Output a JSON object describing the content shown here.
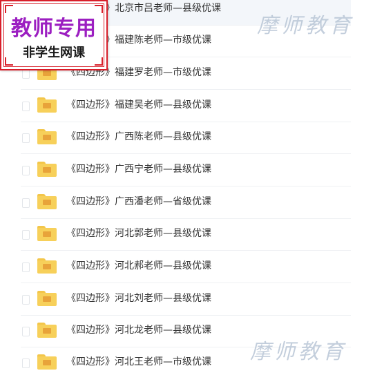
{
  "files": [
    {
      "name": "《四边形》北京市吕老师—县级优课",
      "icon": "folder-icon"
    },
    {
      "name": "《四边形》福建陈老师—市级优课",
      "icon": "folder-icon"
    },
    {
      "name": "《四边形》福建罗老师—市级优课",
      "icon": "folder-icon"
    },
    {
      "name": "《四边形》福建吴老师—县级优课",
      "icon": "folder-icon"
    },
    {
      "name": "《四边形》广西陈老师—县级优课",
      "icon": "folder-icon"
    },
    {
      "name": "《四边形》广西宁老师—县级优课",
      "icon": "folder-icon"
    },
    {
      "name": "《四边形》广西潘老师—省级优课",
      "icon": "folder-icon"
    },
    {
      "name": "《四边形》河北郭老师—县级优课",
      "icon": "folder-icon"
    },
    {
      "name": "《四边形》河北郝老师—县级优课",
      "icon": "folder-icon"
    },
    {
      "name": "《四边形》河北刘老师—县级优课",
      "icon": "folder-icon"
    },
    {
      "name": "《四边形》河北龙老师—县级优课",
      "icon": "folder-icon"
    },
    {
      "name": "《四边形》河北王老师—市级优课",
      "icon": "folder-icon"
    }
  ],
  "stamp": {
    "line1": "教师专用",
    "line2": "非学生网课"
  },
  "watermark": {
    "top": "摩师教育",
    "bottom": "摩师教育"
  },
  "colors": {
    "stamp_border": "#d81f2a",
    "stamp_title": "#9c1fc1",
    "folder": "#f7d05a",
    "watermark": "#b9c6d6"
  }
}
